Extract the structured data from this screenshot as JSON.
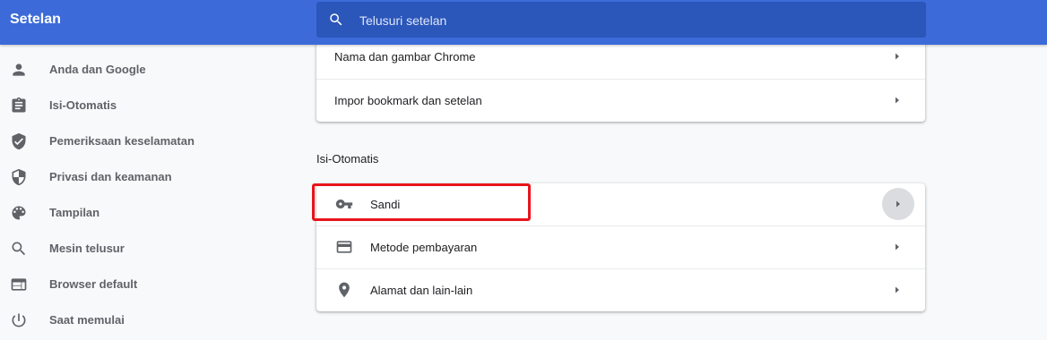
{
  "header": {
    "title": "Setelan",
    "search_placeholder": "Telusuri setelan",
    "search_icon": "search-icon"
  },
  "sidebar": {
    "items": [
      {
        "label": "Anda dan Google",
        "icon": "person-icon"
      },
      {
        "label": "Isi-Otomatis",
        "icon": "clipboard-icon"
      },
      {
        "label": "Pemeriksaan keselamatan",
        "icon": "shield-check-icon"
      },
      {
        "label": "Privasi dan keamanan",
        "icon": "shield-icon"
      },
      {
        "label": "Tampilan",
        "icon": "palette-icon"
      },
      {
        "label": "Mesin telusur",
        "icon": "search-icon"
      },
      {
        "label": "Browser default",
        "icon": "browser-icon"
      },
      {
        "label": "Saat memulai",
        "icon": "power-icon"
      }
    ]
  },
  "people_card": {
    "rows": [
      {
        "label": "Nama dan gambar Chrome"
      },
      {
        "label": "Impor bookmark dan setelan"
      }
    ]
  },
  "autofill": {
    "title": "Isi-Otomatis",
    "rows": [
      {
        "label": "Sandi",
        "icon": "key-icon"
      },
      {
        "label": "Metode pembayaran",
        "icon": "credit-card-icon"
      },
      {
        "label": "Alamat dan lain-lain",
        "icon": "location-pin-icon"
      }
    ]
  },
  "colors": {
    "header_bg": "#3c6bd9",
    "search_bg": "#2b56ba",
    "highlight": "#e8141c",
    "page_bg": "#f8f9fa"
  }
}
